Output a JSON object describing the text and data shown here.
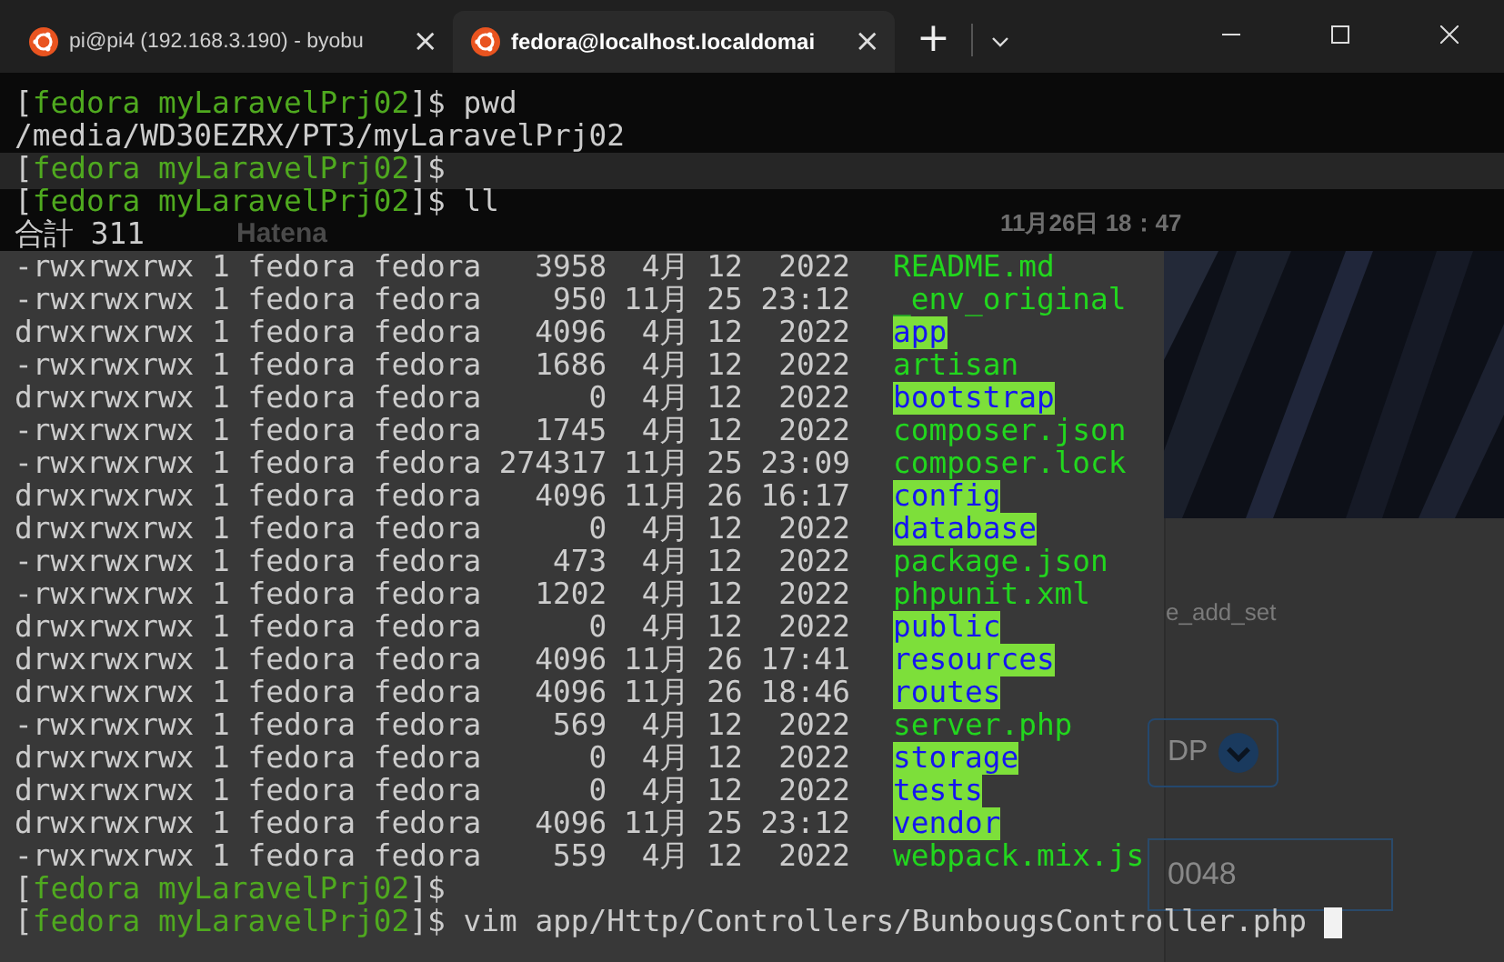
{
  "tabs": [
    {
      "title": "pi@pi4 (192.168.3.190) - byobu",
      "selected": false,
      "close": "×"
    },
    {
      "title": "fedora@localhost.localdomai",
      "selected": true,
      "close": "×"
    }
  ],
  "new_tab": "+",
  "backdrop": {
    "clock": "11月26日 18：47",
    "brand": "Hatena",
    "field_1": "e_add_set",
    "select": "DP",
    "field_2": "0048"
  },
  "lines": [
    {
      "kind": "prompt",
      "open": "[",
      "context": "fedora myLaravelPrj02",
      "close": "]$",
      "command": "pwd"
    },
    {
      "kind": "output",
      "text": "/media/WD30EZRX/PT3/myLaravelPrj02"
    },
    {
      "kind": "prompt",
      "open": "[",
      "context": "fedora myLaravelPrj02",
      "close": "]$"
    },
    {
      "kind": "prompt",
      "open": "[",
      "context": "fedora myLaravelPrj02",
      "close": "]$",
      "command": "ll"
    },
    {
      "kind": "output",
      "text": "合計 311"
    },
    {
      "kind": "file",
      "info": "-rwxrwxrwx 1 fedora fedora   3958",
      "date": " 4月 12  2022",
      "name": "README.md"
    },
    {
      "kind": "file",
      "info": "-rwxrwxrwx 1 fedora fedora    950",
      "date": "11月 25 23:12",
      "name": "_env_original"
    },
    {
      "kind": "dir",
      "info": "drwxrwxrwx 1 fedora fedora   4096",
      "date": " 4月 12  2022",
      "name": "app"
    },
    {
      "kind": "file",
      "info": "-rwxrwxrwx 1 fedora fedora   1686",
      "date": " 4月 12  2022",
      "name": "artisan"
    },
    {
      "kind": "dir",
      "info": "drwxrwxrwx 1 fedora fedora      0",
      "date": " 4月 12  2022",
      "name": "bootstrap"
    },
    {
      "kind": "file",
      "info": "-rwxrwxrwx 1 fedora fedora   1745",
      "date": " 4月 12  2022",
      "name": "composer.json"
    },
    {
      "kind": "file",
      "info": "-rwxrwxrwx 1 fedora fedora 274317",
      "date": "11月 25 23:09",
      "name": "composer.lock"
    },
    {
      "kind": "dir",
      "info": "drwxrwxrwx 1 fedora fedora   4096",
      "date": "11月 26 16:17",
      "name": "config"
    },
    {
      "kind": "dir",
      "info": "drwxrwxrwx 1 fedora fedora      0",
      "date": " 4月 12  2022",
      "name": "database"
    },
    {
      "kind": "file",
      "info": "-rwxrwxrwx 1 fedora fedora    473",
      "date": " 4月 12  2022",
      "name": "package.json"
    },
    {
      "kind": "file",
      "info": "-rwxrwxrwx 1 fedora fedora   1202",
      "date": " 4月 12  2022",
      "name": "phpunit.xml"
    },
    {
      "kind": "dir",
      "info": "drwxrwxrwx 1 fedora fedora      0",
      "date": " 4月 12  2022",
      "name": "public"
    },
    {
      "kind": "dir",
      "info": "drwxrwxrwx 1 fedora fedora   4096",
      "date": "11月 26 17:41",
      "name": "resources"
    },
    {
      "kind": "dir",
      "info": "drwxrwxrwx 1 fedora fedora   4096",
      "date": "11月 26 18:46",
      "name": "routes"
    },
    {
      "kind": "file",
      "info": "-rwxrwxrwx 1 fedora fedora    569",
      "date": " 4月 12  2022",
      "name": "server.php"
    },
    {
      "kind": "dir",
      "info": "drwxrwxrwx 1 fedora fedora      0",
      "date": " 4月 12  2022",
      "name": "storage"
    },
    {
      "kind": "dir",
      "info": "drwxrwxrwx 1 fedora fedora      0",
      "date": " 4月 12  2022",
      "name": "tests"
    },
    {
      "kind": "dir",
      "info": "drwxrwxrwx 1 fedora fedora   4096",
      "date": "11月 25 23:12",
      "name": "vendor"
    },
    {
      "kind": "file",
      "info": "-rwxrwxrwx 1 fedora fedora    559",
      "date": " 4月 12  2022",
      "name": "webpack.mix.js"
    },
    {
      "kind": "prompt",
      "open": "[",
      "context": "fedora myLaravelPrj02",
      "close": "]$"
    },
    {
      "kind": "prompt",
      "open": "[",
      "context": "fedora myLaravelPrj02",
      "close": "]$",
      "command": "vim app/Http/Controllers/BunbougsController.php",
      "cursor": true
    }
  ]
}
